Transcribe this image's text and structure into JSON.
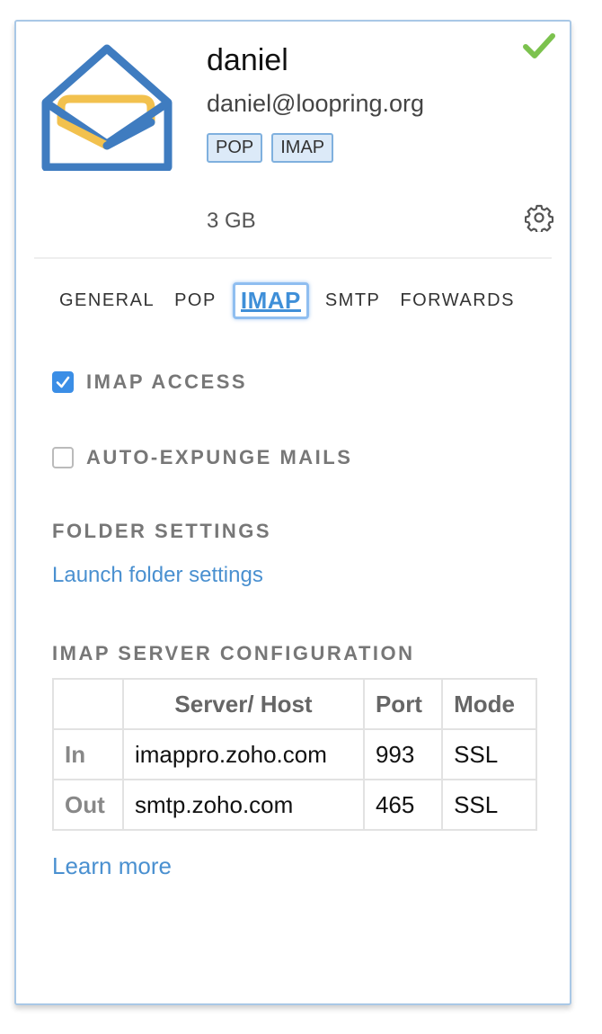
{
  "account": {
    "name": "daniel",
    "email": "daniel@loopring.org",
    "badges": [
      "POP",
      "IMAP"
    ],
    "storage": "3 GB"
  },
  "tabs": [
    "GENERAL",
    "POP",
    "IMAP",
    "SMTP",
    "FORWARDS"
  ],
  "active_tab": "IMAP",
  "options": {
    "imap_access": {
      "label": "IMAP ACCESS",
      "checked": true
    },
    "auto_expunge": {
      "label": "AUTO-EXPUNGE MAILS",
      "checked": false
    }
  },
  "folder_settings": {
    "title": "FOLDER SETTINGS",
    "link": "Launch folder settings"
  },
  "server_config": {
    "title": "IMAP SERVER CONFIGURATION",
    "headers": [
      "",
      "Server/ Host",
      "Port",
      "Mode"
    ],
    "rows": [
      {
        "direction": "In",
        "host": "imappro.zoho.com",
        "port": "993",
        "mode": "SSL"
      },
      {
        "direction": "Out",
        "host": "smtp.zoho.com",
        "port": "465",
        "mode": "SSL"
      }
    ]
  },
  "learn_more": "Learn more",
  "colors": {
    "accent": "#3f8fd8",
    "link": "#4a90d0",
    "check_green": "#7cc24e",
    "logo_blue": "#3f7cc0",
    "logo_yellow": "#f2c14e"
  },
  "icons": [
    "mail-logo-icon",
    "check-icon",
    "gear-icon",
    "checkbox-check-icon"
  ]
}
